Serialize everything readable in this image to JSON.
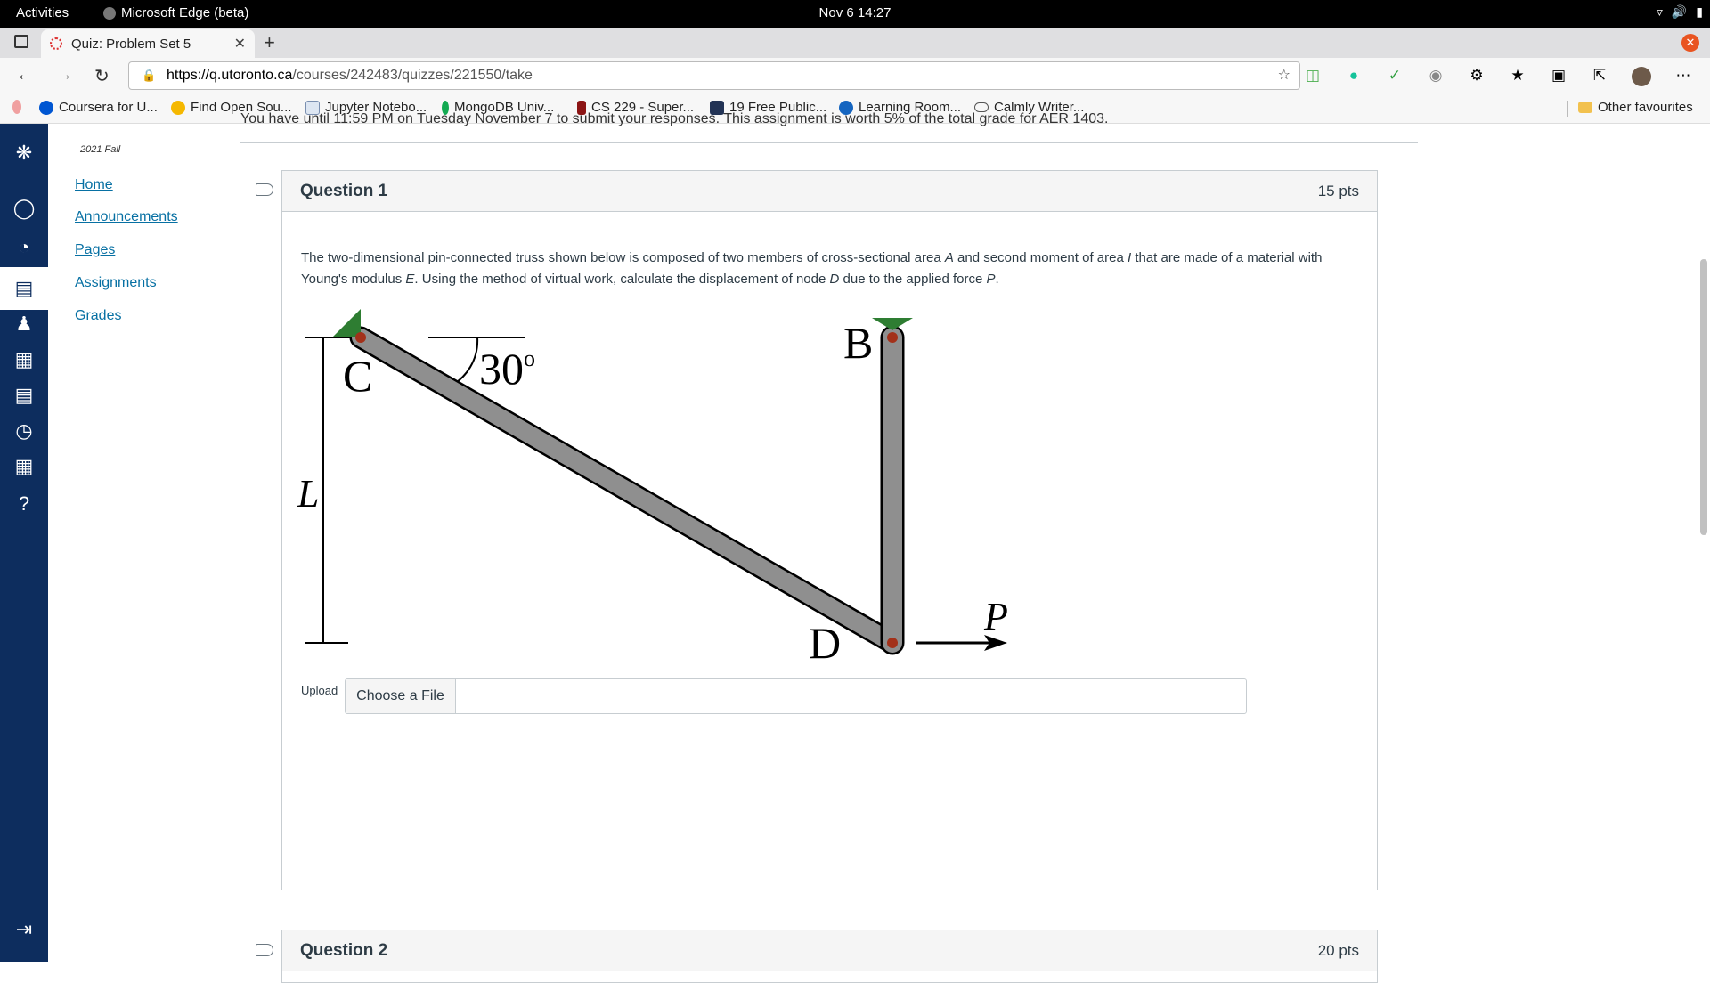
{
  "system": {
    "activities": "Activities",
    "app_name": "Microsoft Edge (beta)",
    "clock": "Nov 6  14:27"
  },
  "browser": {
    "tab_title": "Quiz: Problem Set 5",
    "url_host": "https://q.utoronto.ca",
    "url_path": "/courses/242483/quizzes/221550/take",
    "bookmarks": [
      "Coursera for U...",
      "Find Open Sou...",
      "Jupyter Notebo...",
      "MongoDB Univ...",
      "CS 229 - Super...",
      "19 Free Public...",
      "Learning Room...",
      "Calmly Writer..."
    ],
    "other_favourites": "Other favourites"
  },
  "course_nav": {
    "term": "2021 Fall",
    "items": [
      "Home",
      "Announcements",
      "Pages",
      "Assignments",
      "Grades"
    ]
  },
  "intro": "You have until 11:59 PM on Tuesday November 7 to submit your responses. This assignment is worth 5% of the total grade for AER 1403.",
  "questions": [
    {
      "title": "Question 1",
      "points": "15 pts",
      "text_parts": [
        "The two-dimensional pin-connected truss shown below is composed of two members of cross-sectional area ",
        "A",
        " and second moment of area ",
        "I",
        " that are made of a material with Young's modulus ",
        "E",
        ". Using the method of virtual work, calculate the displacement of node ",
        "D",
        " due to the applied force ",
        "P",
        "."
      ],
      "diagram": {
        "label_c": "C",
        "label_b": "B",
        "label_d": "D",
        "label_l": "L",
        "label_p": "P",
        "angle": "30",
        "angle_unit": "o"
      },
      "upload_label": "Upload",
      "upload_button": "Choose a File"
    },
    {
      "title": "Question 2",
      "points": "20 pts"
    }
  ],
  "colors": {
    "nav_bg": "#0d2d5e",
    "link": "#0770a3",
    "support_green": "#2e7d32",
    "member_gray": "#8f8f8f",
    "pin_red": "#a3311a"
  }
}
